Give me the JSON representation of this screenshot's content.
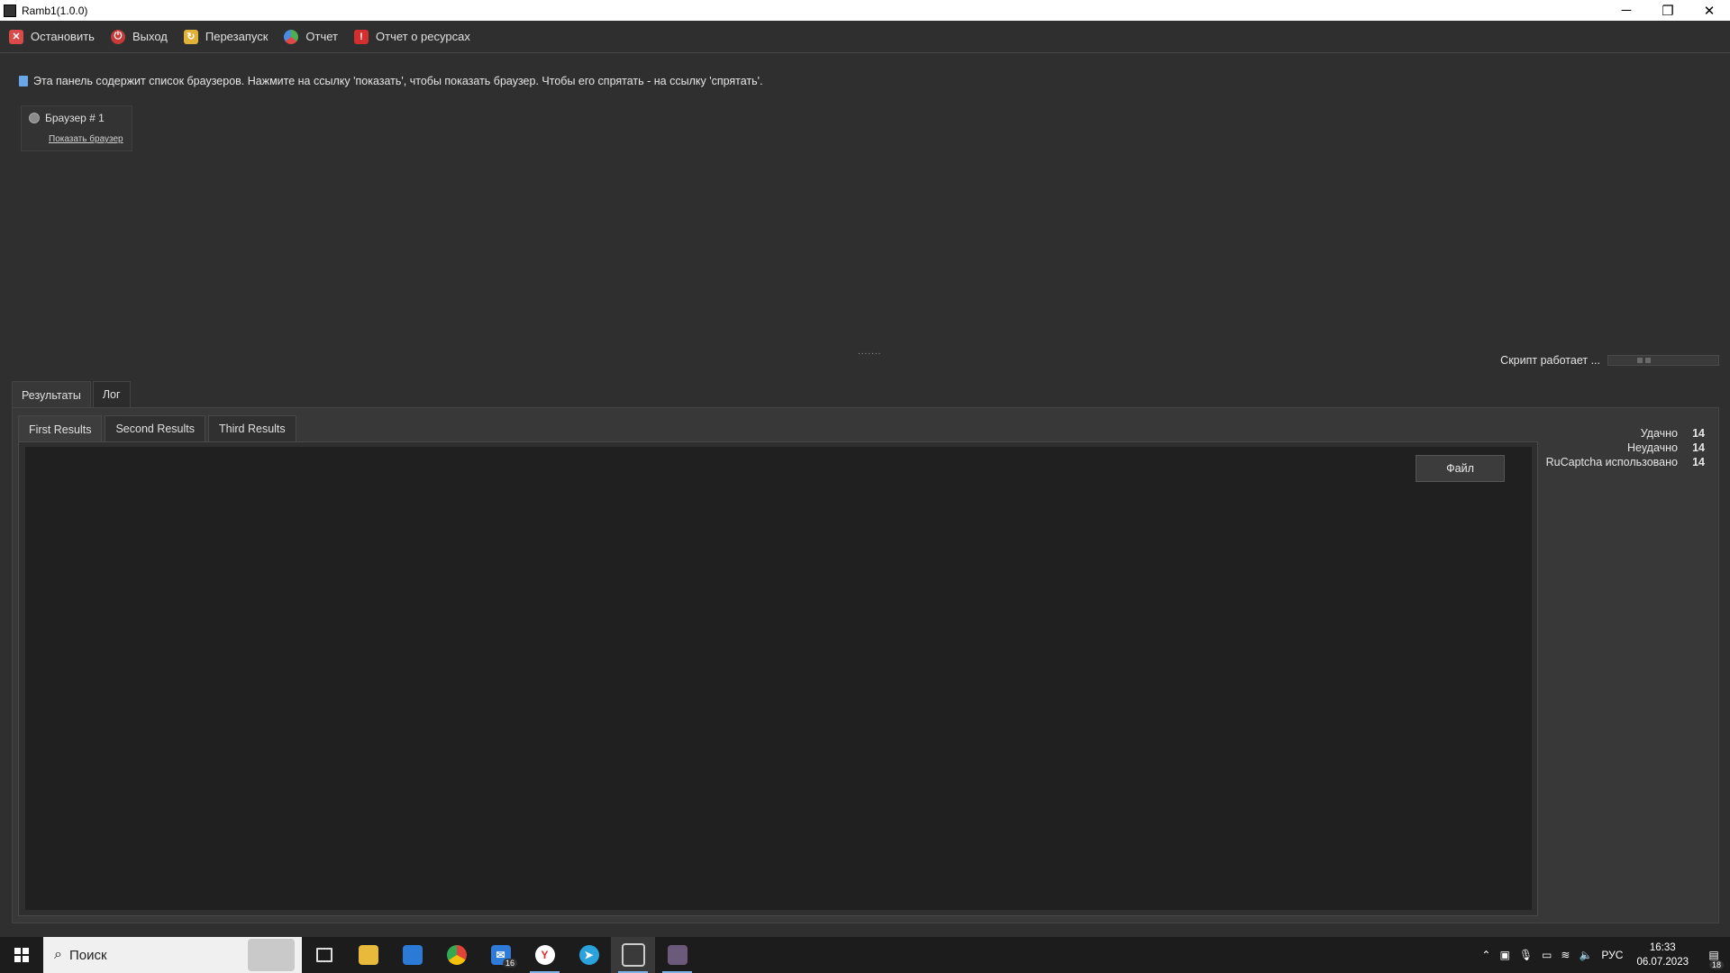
{
  "window": {
    "title": "Ramb1(1.0.0)",
    "minimize": "─",
    "maximize": "❐",
    "close": "✕"
  },
  "toolbar": {
    "stop_label": "Остановить",
    "exit_label": "Выход",
    "restart_label": "Перезапуск",
    "report_label": "Отчет",
    "resource_report_label": "Отчет о ресурсах"
  },
  "info_text": "Эта панель содержит список браузеров. Нажмите на ссылку 'показать', чтобы показать браузер. Чтобы его спрятать - на ссылку 'спрятать'.",
  "browser": {
    "title": "Браузер # 1",
    "link": "Показать браузер"
  },
  "splitter": ".......",
  "script_status": "Скрипт работает ...",
  "outer_tabs": [
    "Результаты",
    "Лог"
  ],
  "inner_tabs": [
    "First Results",
    "Second Results",
    "Third Results"
  ],
  "file_button": "Файл",
  "stats": [
    {
      "label": "Удачно",
      "value": "14"
    },
    {
      "label": "Неудачно",
      "value": "14"
    },
    {
      "label": "RuCaptcha использовано",
      "value": "14"
    }
  ],
  "taskbar": {
    "search_placeholder": "Поиск",
    "mail_badge": "16",
    "lang": "РУС",
    "time": "16:33",
    "date": "06.07.2023",
    "notif_count": "18"
  },
  "icons": {
    "stop": "close-icon",
    "exit": "power-icon",
    "restart": "restart-icon",
    "report": "pie-chart-icon",
    "resource": "warning-icon"
  },
  "colors": {
    "background": "#2f2f2f",
    "results_area": "#202020",
    "taskbar": "#1c1c1c"
  }
}
